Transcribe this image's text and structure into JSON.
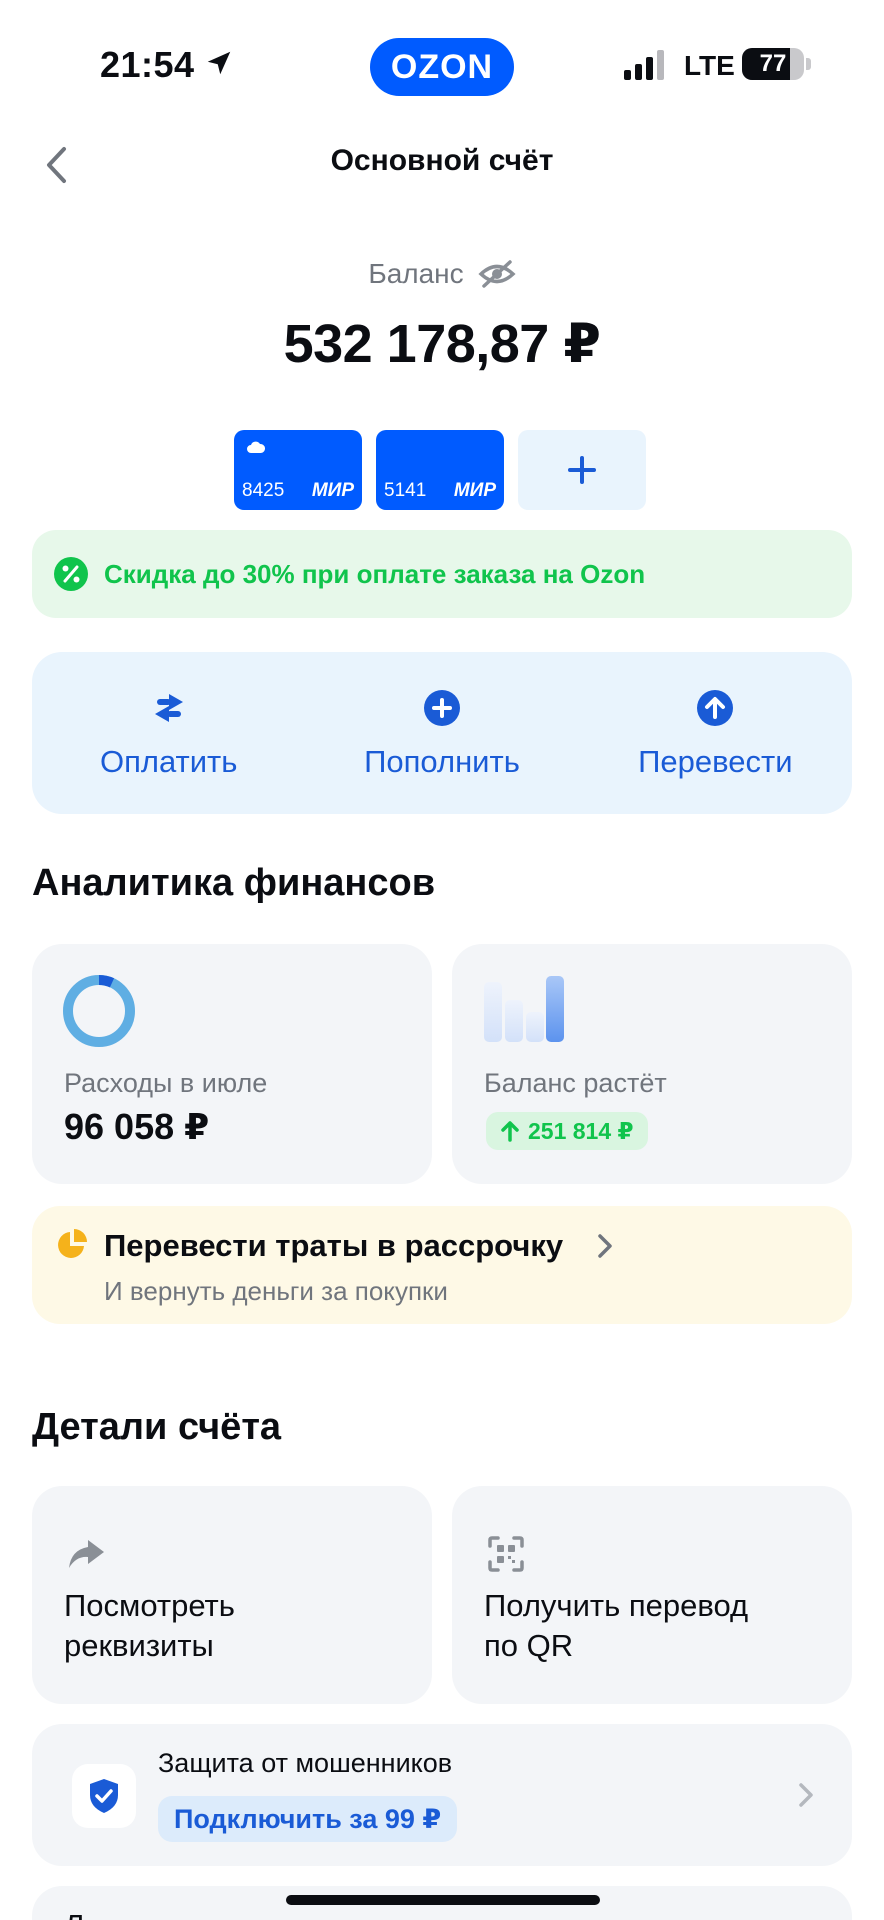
{
  "status_bar": {
    "time": "21:54",
    "network": "LTE",
    "battery": "77",
    "battery_level": 0.77
  },
  "app": {
    "logo": "OZON"
  },
  "header": {
    "title": "Основной счёт"
  },
  "balance": {
    "label": "Баланс",
    "amount": "532 178,87 ₽"
  },
  "cards": [
    {
      "number": "8425",
      "brand": "МИР"
    },
    {
      "number": "5141",
      "brand": "МИР"
    }
  ],
  "add_card": {
    "symbol": "+"
  },
  "promo": {
    "text": "Скидка до 30% при оплате заказа на Ozon"
  },
  "actions": [
    {
      "label": "Оплатить",
      "icon": "swap-arrows-icon"
    },
    {
      "label": "Пополнить",
      "icon": "plus-circle-icon"
    },
    {
      "label": "Перевести",
      "icon": "arrow-up-circle-icon"
    }
  ],
  "analytics": {
    "title": "Аналитика финансов",
    "expenses": {
      "label": "Расходы в июле",
      "value": "96 058 ₽"
    },
    "growth": {
      "label": "Баланс растёт",
      "badge": "251 814 ₽"
    }
  },
  "installment": {
    "title": "Перевести траты в рассрочку",
    "subtitle": "И вернуть деньги за покупки"
  },
  "details": {
    "title": "Детали счёта",
    "requisites": {
      "line1": "Посмотреть",
      "line2": "реквизиты"
    },
    "qr": {
      "line1": "Получить перевод",
      "line2": "по QR"
    }
  },
  "fraud": {
    "title": "Защита от мошенников",
    "button": "Подключить за 99 ₽"
  },
  "next_item": {
    "peek": "Л"
  },
  "colors": {
    "brand": "#005bff",
    "action_text": "#1a5bd6",
    "promo_green": "#10c44c",
    "installment_bg": "#fef9e6"
  }
}
